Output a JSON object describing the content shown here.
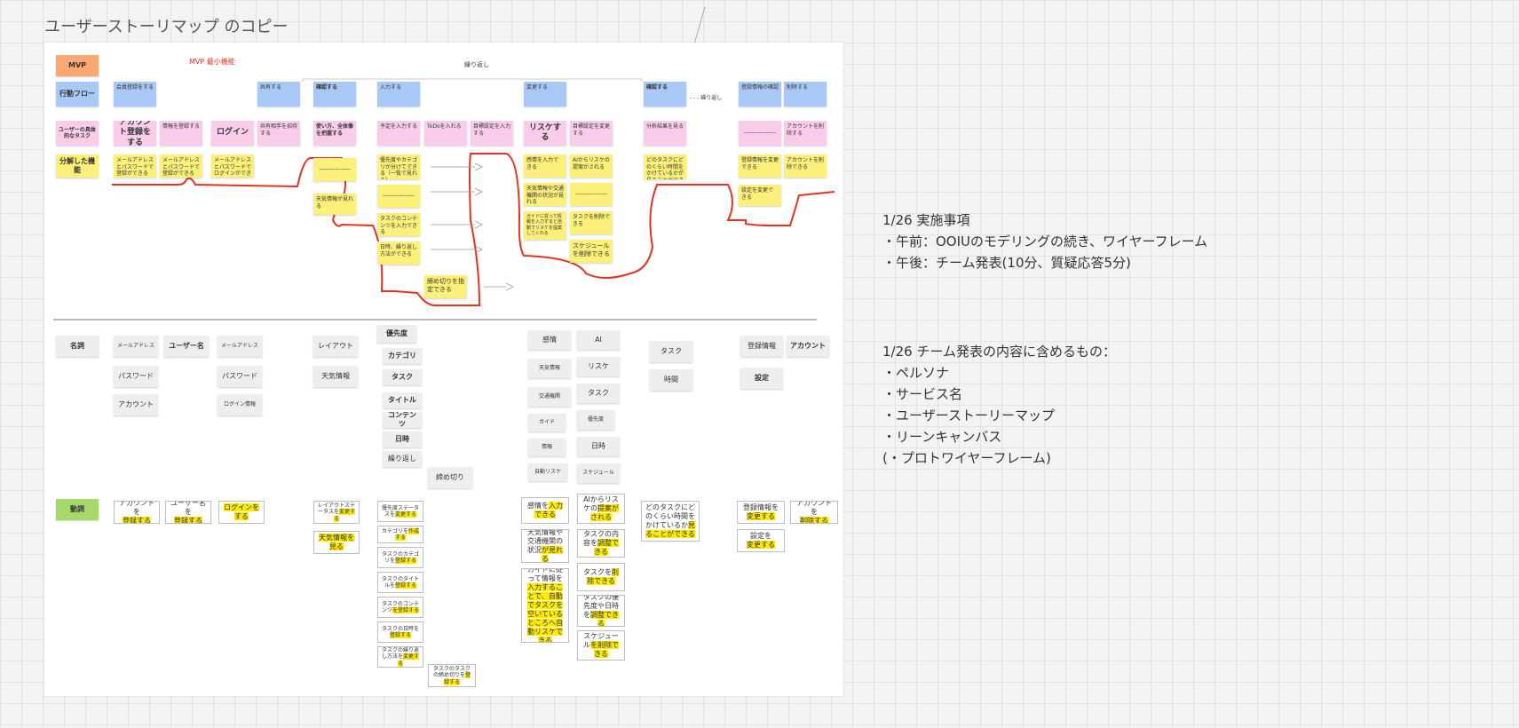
{
  "title": "ユーザーストーリマップ のコピー",
  "top_note": "—————————",
  "labels": {
    "mvp": "MVP",
    "mvp_note": "MVP 最小機能",
    "repeat": "繰り返し",
    "repeat2": "- - - 繰り返し",
    "flow": "行動フロー",
    "task": "ユーザーの具体的なタスク",
    "feature": "分解した機能",
    "noun": "名詞",
    "verb": "動詞"
  },
  "flow": {
    "f1": "会員登録をする",
    "f2": "共有する",
    "f3": "確認する",
    "f4": "入力する",
    "f5": "変更する",
    "f6": "確認する",
    "f7": "登録情報の確認",
    "f8": "削除する"
  },
  "tasks": {
    "t1": "アカウント登録をする",
    "t2": "情報を登録する",
    "t3": "ログイン",
    "t4": "共有相手を招待する",
    "t5": "使い方、全体像を把握する",
    "t6": "予定を入力する",
    "t7": "ToDoを入れる",
    "t8": "目標設定を入力する",
    "t9": "リスケする",
    "t10": "目標設定を変更する",
    "t11": "分析結果を見る",
    "t12": "——————",
    "t13": "アカウントを削除する"
  },
  "features": {
    "a1": "メールアドレスとパスワードで登録ができる",
    "a2": "メールアドレスとパスワードで登録ができる",
    "a3": "メールアドレスとパスワードでログインができる",
    "b1": "——————",
    "b2": "天気情報が見れる",
    "c1": "優先度やカテゴリが分けてできる（一覧で見れる）",
    "c2": "——————",
    "c3": "タスクのコンテンツを入力できる",
    "c4": "日時、繰り返し方法ができる",
    "c5": "締め切りを指定できる",
    "d1": "感情を入力できる",
    "d2": "天気情報や交通機関の状況が見れる",
    "d3": "ガイドに従って情報を入力すると自動でリスケを提案してくれる",
    "e1": "AIからリスケの提案がされる",
    "e2": "——————",
    "e3": "タスクを削除できる",
    "e4": "スケジュールを削除できる",
    "f1": "どのタスクにどのくらい時間をかけているかが見ることができる",
    "g1": "登録情報を変更できる",
    "g2": "設定を変更できる",
    "g3": "アカウントを削除できる"
  },
  "nouns": {
    "n1": "メールアドレス",
    "n2": "パスワード",
    "n3": "アカウント",
    "n4": "ユーザー名",
    "n5": "メールアドレス",
    "n6": "パスワード",
    "n7": "ログイン情報",
    "n8": "レイアウト",
    "n9": "天気情報",
    "n10": "優先度",
    "n11": "カテゴリ",
    "n12": "タスク",
    "n13": "タイトル",
    "n14": "コンテンツ",
    "n15": "日時",
    "n16": "繰り返し",
    "n17": "締め切り",
    "n18": "感情",
    "n19": "天気情報",
    "n20": "交通機関",
    "n21": "ガイド",
    "n22": "情報",
    "n23": "自動リスケ",
    "n24": "AI",
    "n25": "リスケ",
    "n26": "タスク",
    "n27": "優先度",
    "n28": "日時",
    "n29": "スケジュール",
    "n30": "タスク",
    "n31": "時間",
    "n32": "登録情報",
    "n33": "アカウント",
    "n34": "設定"
  },
  "verbs": {
    "v1": {
      "a": "アカウントを",
      "b": "登録する"
    },
    "v2": {
      "a": "ユーザー名を",
      "b": "登録する"
    },
    "v3": {
      "a": "",
      "b": "ログインをする"
    },
    "v4": {
      "a": "レイアウトステータスを",
      "b": "変更する"
    },
    "v5": {
      "a": "",
      "b": "天気情報を見る"
    },
    "v6": {
      "a": "優先度ステータスを",
      "b": "変更する"
    },
    "v7": {
      "a": "カテゴリを",
      "b": "作成する"
    },
    "v8": {
      "a": "タスクのカテゴリを",
      "b": "登録する"
    },
    "v9": {
      "a": "タスクのタイトルを",
      "b": "登録する"
    },
    "v10": {
      "a": "タスクのコンテンツ",
      "b": "を登録する"
    },
    "v11": {
      "a": "タスクの日時を",
      "b": "登録する"
    },
    "v12": {
      "a": "タスクの繰り返し方法を",
      "b": "変更する"
    },
    "v13": {
      "a": "タスクのタスクの締め切りを",
      "b": "登録する"
    },
    "v14": {
      "a": "感情を",
      "b": "入力できる"
    },
    "v15": {
      "a": "天気情報や交通機関の状況",
      "b": "が見れる"
    },
    "v16": {
      "a": "ガイドに従って情報を",
      "b": "入力することで、自動でタスクを空いているところへ自動リスケできる"
    },
    "v17": {
      "a": "AIからリスケの",
      "b": "提案がされる"
    },
    "v18": {
      "a": "タスクの内容を",
      "b": "調整できる"
    },
    "v19": {
      "a": "タスクを",
      "b": "削除できる"
    },
    "v20": {
      "a": "タスクの優先度や日時を",
      "b": "調整できる"
    },
    "v21": {
      "a": "スケジュール",
      "b": "を削除できる"
    },
    "v22": {
      "a": "どのタスクにどのくらい時間をかけているか",
      "b": "見ることができる"
    },
    "v23": {
      "a": "登録情報を",
      "b": "変更する"
    },
    "v24": {
      "a": "設定を",
      "b": "変更する"
    },
    "v25": {
      "a": "アカウントを",
      "b": "削除する"
    }
  },
  "side1": {
    "title": "1/26 実施事項",
    "l1": "・午前：OOIUのモデリングの続き、ワイヤーフレーム",
    "l2": "・午後：チーム発表(10分、質疑応答5分)"
  },
  "side2": {
    "title": "1/26 チーム発表の内容に含めるもの：",
    "l1": "・ペルソナ",
    "l2": "・サービス名",
    "l3": "・ユーザーストーリーマップ",
    "l4": "・リーンキャンバス",
    "l5": "(・プロトワイヤーフレーム)"
  },
  "colors": {
    "flow": "#a8c8f5",
    "task": "#f9cdea",
    "feature": "#fbf17a",
    "mvp": "#f9a971",
    "verb": "#a6d96a",
    "mvp_line": "#e5321e"
  }
}
